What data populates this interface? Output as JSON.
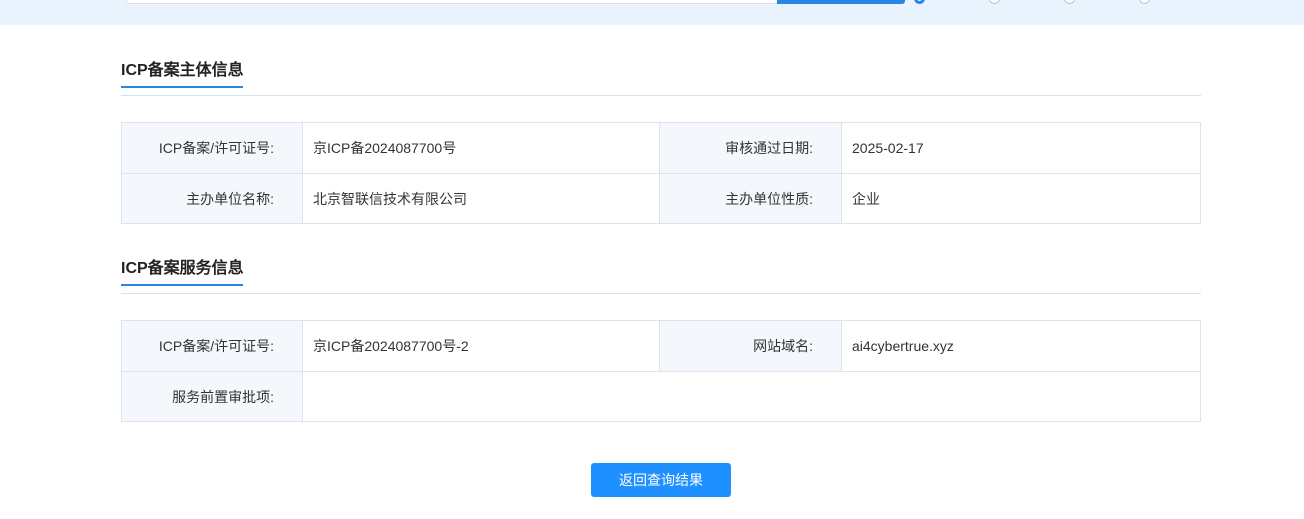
{
  "colors": {
    "accent": "#1e90ff",
    "label_bg": "#f4f8fc",
    "border": "#dde4ec"
  },
  "subject_section": {
    "title": "ICP备案主体信息",
    "rows": [
      {
        "label1": "ICP备案/许可证号:",
        "value1": "京ICP备2024087700号",
        "label2": "审核通过日期:",
        "value2": "2025-02-17"
      },
      {
        "label1": "主办单位名称:",
        "value1": "北京智联信技术有限公司",
        "label2": "主办单位性质:",
        "value2": "企业"
      }
    ]
  },
  "service_section": {
    "title": "ICP备案服务信息",
    "row1": {
      "label1": "ICP备案/许可证号:",
      "value1": "京ICP备2024087700号-2",
      "label2": "网站域名:",
      "value2": "ai4cybertrue.xyz"
    },
    "row2": {
      "label": "服务前置审批项:",
      "value": ""
    }
  },
  "back_button_label": "返回查询结果"
}
